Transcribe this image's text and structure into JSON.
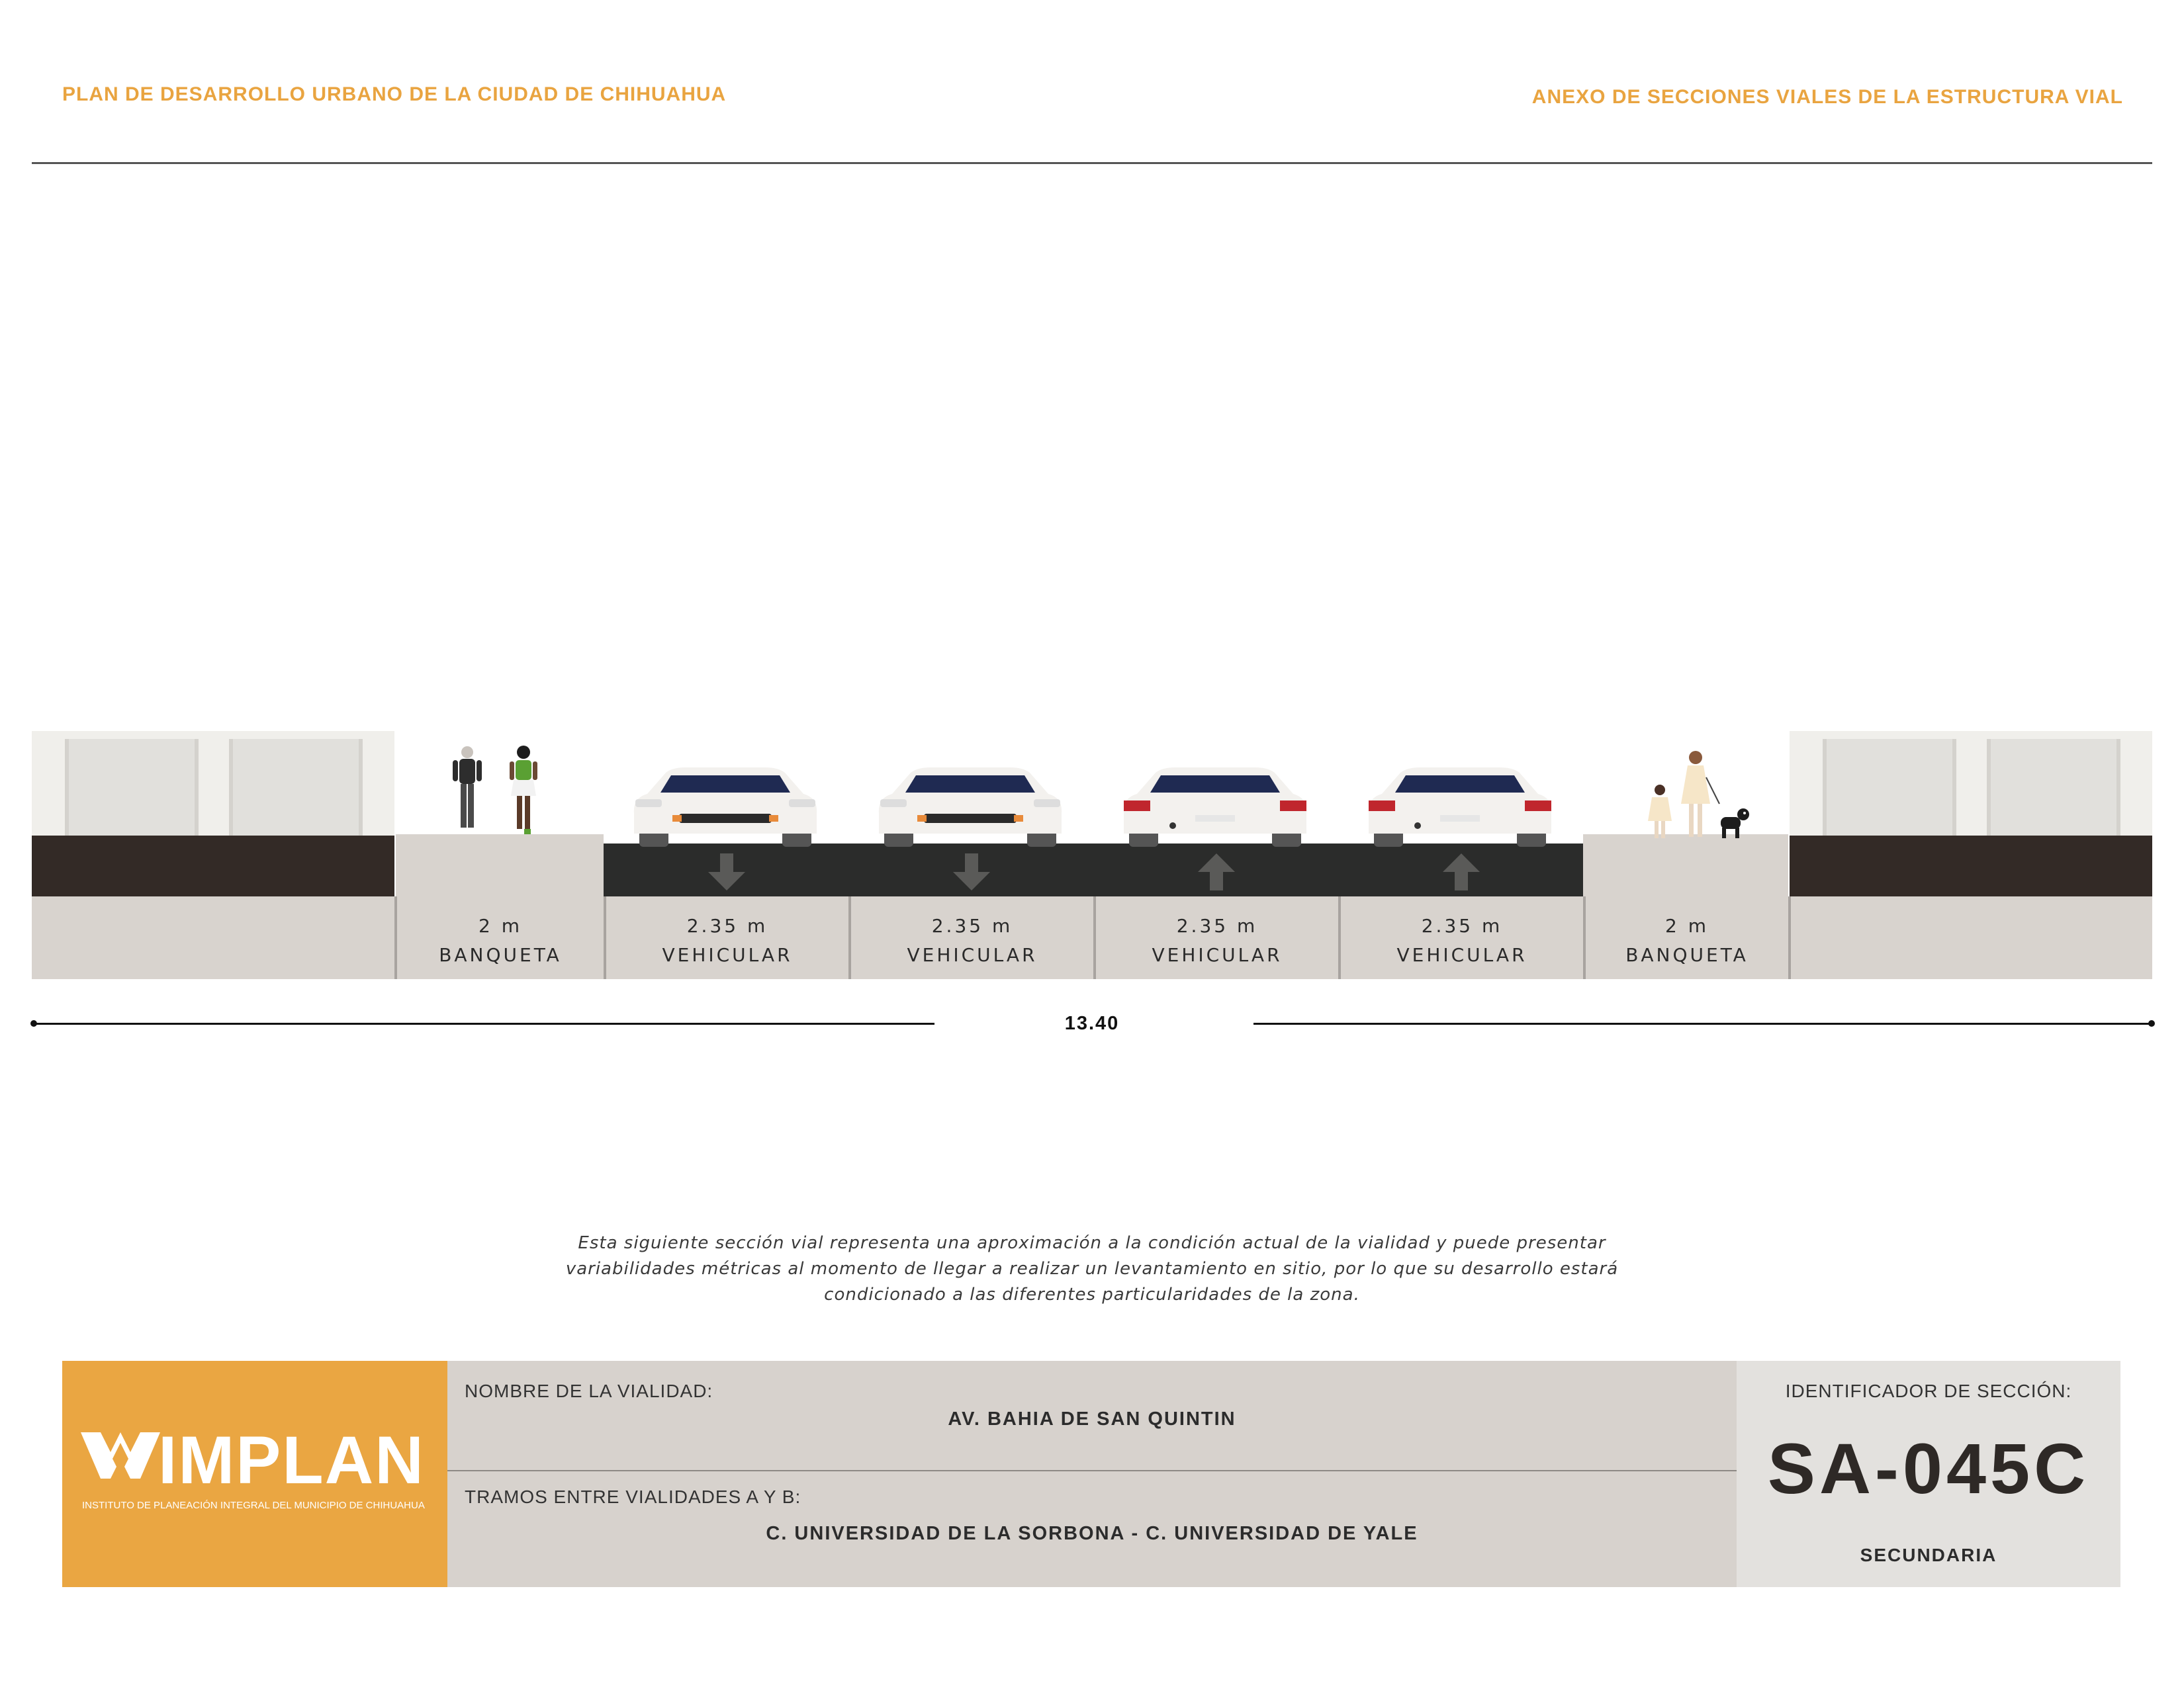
{
  "header": {
    "left_title": "PLAN DE DESARROLLO URBANO DE LA CIUDAD DE CHIHUAHUA",
    "right_title": "ANEXO DE SECCIONES VIALES DE LA ESTRUCTURA VIAL"
  },
  "section": {
    "segments": [
      {
        "width": "2 m",
        "type": "BANQUETA"
      },
      {
        "width": "2.35 m",
        "type": "VEHICULAR",
        "direction": "down"
      },
      {
        "width": "2.35 m",
        "type": "VEHICULAR",
        "direction": "down"
      },
      {
        "width": "2.35 m",
        "type": "VEHICULAR",
        "direction": "up"
      },
      {
        "width": "2.35 m",
        "type": "VEHICULAR",
        "direction": "up"
      },
      {
        "width": "2 m",
        "type": "BANQUETA"
      }
    ],
    "total_width": "13.40",
    "colors": {
      "road": "#2b2c2b",
      "band": "#332a26",
      "sidewalk": "#d8d3ce",
      "arrow": "#5a5a58"
    }
  },
  "note": [
    "Esta siguiente sección vial representa una aproximación a la condición actual de la vialidad y puede presentar",
    "variabilidades métricas al momento de llegar a realizar un levantamiento en sitio, por lo que su desarrollo estará",
    "condicionado a las diferentes particularidades de la zona."
  ],
  "footer": {
    "logo": {
      "word": "IMPLAN",
      "subtitle": "INSTITUTO DE PLANEACIÓN INTEGRAL DEL MUNICIPIO DE CHIHUAHUA",
      "color": "#eaa642"
    },
    "street_label": "NOMBRE DE LA VIALIDAD:",
    "street_name": "AV. BAHIA DE SAN QUINTIN",
    "segment_label": "TRAMOS ENTRE VIALIDADES A Y B:",
    "segment_value": "C. UNIVERSIDAD DE LA SORBONA - C. UNIVERSIDAD DE YALE",
    "id_label": "IDENTIFICADOR DE SECCIÓN:",
    "id_code": "SA-045C",
    "classification": "SECUNDARIA"
  }
}
